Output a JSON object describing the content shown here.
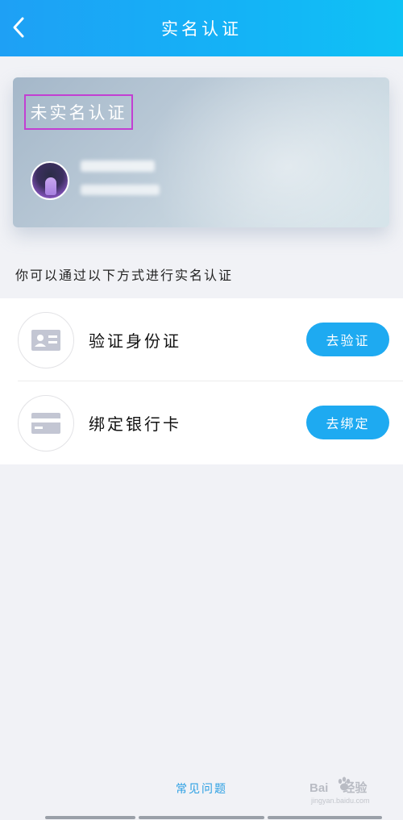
{
  "header": {
    "title": "实名认证",
    "back_icon": "chevron-left-icon"
  },
  "card": {
    "status_label": "未实名认证",
    "avatar_icon": "user-avatar"
  },
  "instruction": "你可以通过以下方式进行实名认证",
  "options": [
    {
      "icon": "id-card-icon",
      "label": "验证身份证",
      "action": "去验证"
    },
    {
      "icon": "bank-card-icon",
      "label": "绑定银行卡",
      "action": "去绑定"
    }
  ],
  "footer": {
    "faq_label": "常见问题"
  },
  "watermark": {
    "brand": "Bai",
    "brand_cn": "经验",
    "url": "jingyan.baidu.com"
  },
  "colors": {
    "header_gradient_start": "#1ea0f5",
    "header_gradient_end": "#0fc2f5",
    "accent_button": "#1eaaf1",
    "status_highlight_border": "#c23fd2",
    "faq_link": "#2a9fe3"
  }
}
